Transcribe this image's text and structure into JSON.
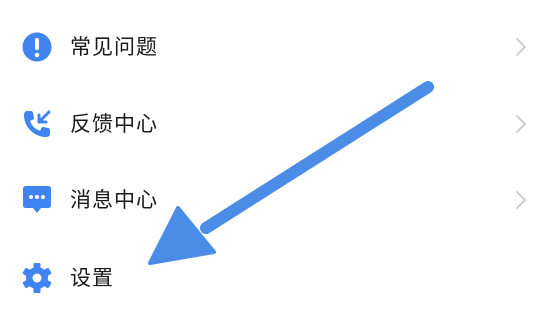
{
  "menu": {
    "items": [
      {
        "label": "常见问题",
        "icon": "info-circle-icon",
        "has_chevron": true
      },
      {
        "label": "反馈中心",
        "icon": "phone-callback-icon",
        "has_chevron": true
      },
      {
        "label": "消息中心",
        "icon": "chat-bubble-icon",
        "has_chevron": true
      },
      {
        "label": "设置",
        "icon": "gear-icon",
        "has_chevron": false
      }
    ]
  },
  "colors": {
    "accent": "#3f84f0",
    "text": "#1a1a1a",
    "chevron": "#c8c8c8",
    "annotation_arrow": "#4a8ce6"
  }
}
